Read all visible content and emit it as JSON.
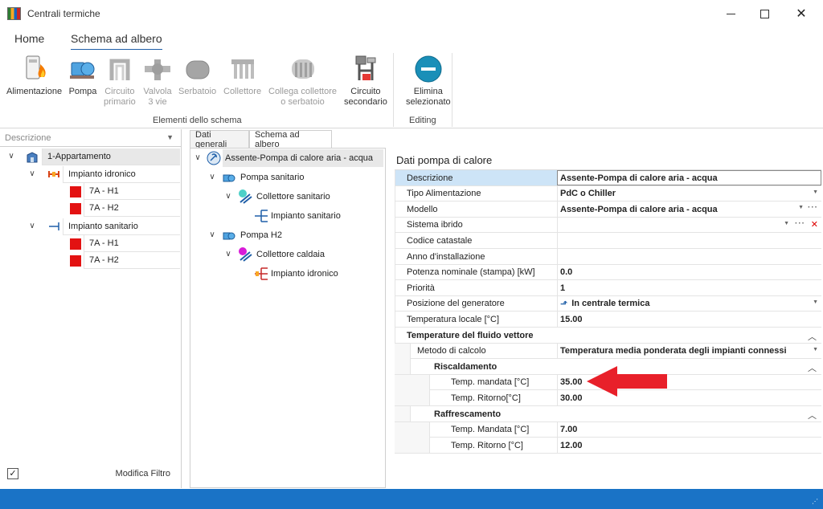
{
  "window": {
    "title": "Centrali termiche"
  },
  "ribbon_tabs": {
    "home": "Home",
    "tree": "Schema ad albero"
  },
  "ribbon": {
    "buttons": [
      {
        "label": "Alimentazione",
        "icon": "boiler-flame-icon"
      },
      {
        "label": "Pompa",
        "icon": "pump-icon"
      },
      {
        "label": "Circuito\nprimario",
        "icon": "primary-circuit-icon"
      },
      {
        "label": "Valvola\n3 vie",
        "icon": "three-way-valve-icon"
      },
      {
        "label": "Serbatoio",
        "icon": "tank-icon"
      },
      {
        "label": "Collettore",
        "icon": "manifold-icon"
      },
      {
        "label": "Collega collettore\no serbatoio",
        "icon": "link-manifold-icon"
      },
      {
        "label": "Circuito\nsecondario",
        "icon": "secondary-circuit-icon"
      },
      {
        "label": "Elimina\nselezionato",
        "icon": "delete-minus-icon"
      }
    ],
    "group_elements": "Elementi dello schema",
    "group_editing": "Editing"
  },
  "left": {
    "filter_placeholder": "Descrizione",
    "tree": {
      "root": "1-Appartamento",
      "idronico": "Impianto idronico",
      "idronico_items": [
        "7A - H1",
        "7A - H2"
      ],
      "sanitario": "Impianto sanitario",
      "sanitario_items": [
        "7A - H1",
        "7A - H2"
      ]
    },
    "footer_label": "Modifica Filtro",
    "footer_check": "✓"
  },
  "tabs": {
    "general": "Dati generali",
    "tree": "Schema ad albero"
  },
  "mid_tree": {
    "root": "Assente-Pompa di calore aria - acqua",
    "pump1": "Pompa sanitario",
    "coll1": "Collettore sanitario",
    "plant1": "Impianto sanitario",
    "pump2": "Pompa H2",
    "coll2": "Collettore caldaia",
    "plant2": "Impianto idronico"
  },
  "props": {
    "title": "Dati pompa di calore",
    "rows": {
      "descrizione": {
        "name": "Descrizione",
        "value": "Assente-Pompa di calore aria - acqua"
      },
      "tipo": {
        "name": "Tipo Alimentazione",
        "value": "PdC o Chiller"
      },
      "modello": {
        "name": "Modello",
        "value": "Assente-Pompa di calore aria - acqua"
      },
      "ibrido": {
        "name": "Sistema ibrido",
        "value": ""
      },
      "codice": {
        "name": "Codice catastale",
        "value": ""
      },
      "anno": {
        "name": "Anno d'installazione",
        "value": ""
      },
      "potenza": {
        "name": "Potenza nominale (stampa) [kW]",
        "value": "0.0"
      },
      "priorita": {
        "name": "Priorità",
        "value": "1"
      },
      "posizione": {
        "name": "Posizione del generatore",
        "value": "In centrale termica"
      },
      "temp_locale": {
        "name": "Temperatura locale [°C]",
        "value": "15.00"
      },
      "cat_fluido": {
        "name": "Temperature del fluido vettore"
      },
      "metodo": {
        "name": "Metodo di calcolo",
        "value": "Temperatura media ponderata degli impianti connessi"
      },
      "cat_risc": {
        "name": "Riscaldamento"
      },
      "mandata_r": {
        "name": "Temp. mandata [°C]",
        "value": "35.00"
      },
      "ritorno_r": {
        "name": "Temp. Ritorno[°C]",
        "value": "30.00"
      },
      "cat_raff": {
        "name": "Raffrescamento"
      },
      "mandata_f": {
        "name": "Temp. Mandata [°C]",
        "value": "7.00"
      },
      "ritorno_f": {
        "name": "Temp. Ritorno [°C]",
        "value": "12.00"
      }
    }
  },
  "colors": {
    "accent": "#1a73c6",
    "selection": "#cde4f7",
    "annotation_arrow": "#e8202a",
    "red_item": "#e31212"
  }
}
